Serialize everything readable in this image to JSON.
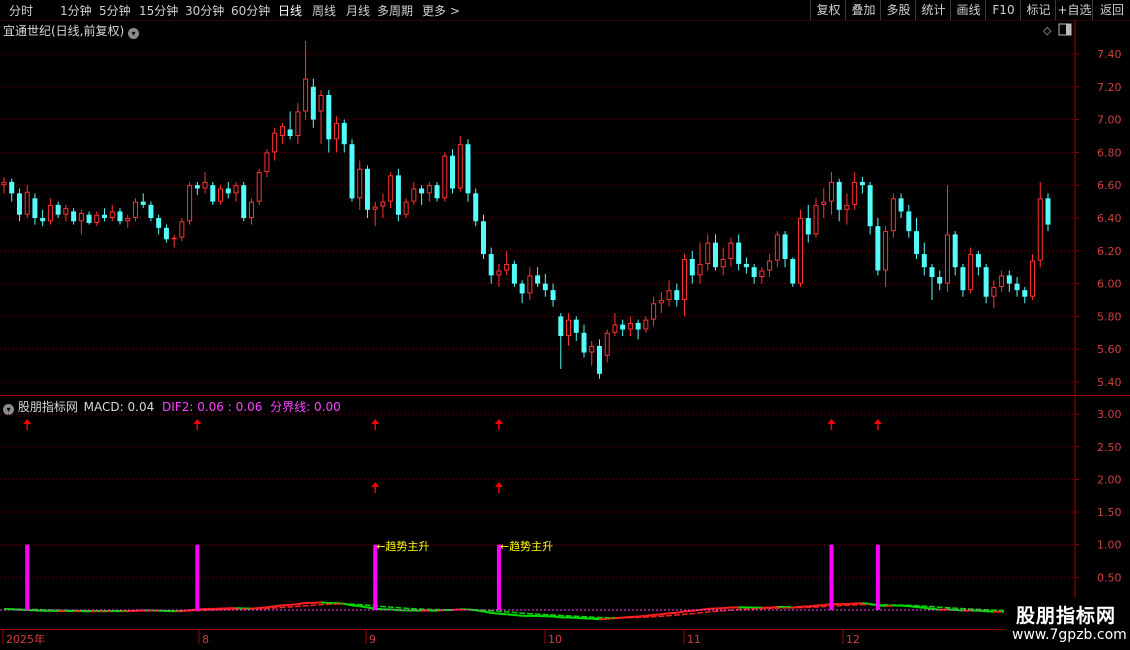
{
  "toolbar": {
    "periods": [
      "分时",
      "1分钟",
      "5分钟",
      "15分钟",
      "30分钟",
      "60分钟",
      "日线",
      "周线",
      "月线",
      "多周期",
      "更多 >"
    ],
    "active_period": "日线",
    "right_buttons": [
      "复权",
      "叠加",
      "多股",
      "统计",
      "画线",
      "F10",
      "标记",
      "+自选",
      "返回"
    ]
  },
  "main_panel": {
    "title": "宜通世纪(日线,前复权)",
    "price_axis": [
      "7.40",
      "7.20",
      "7.00",
      "6.80",
      "6.60",
      "6.40",
      "6.20",
      "6.00",
      "5.80",
      "5.60",
      "5.40"
    ]
  },
  "indicator_panel": {
    "name": "股朋指标网",
    "macd_label": "MACD: 0.04",
    "dif2_label": "DIF2: 0.06",
    "extra_label": ": 0.06",
    "divider_label": "分界线: 0.00",
    "axis": [
      "3.00",
      "2.50",
      "2.00",
      "1.50",
      "1.00",
      "0.50"
    ],
    "signal_text": "←趋势主升"
  },
  "date_axis": [
    "2025年",
    "8",
    "9",
    "10",
    "11",
    "12"
  ],
  "watermark": {
    "title": "股朋指标网",
    "url": "www.7gpzb.com"
  },
  "colors": {
    "up": "#ff3232",
    "down": "#54fcfc",
    "signal_bar": "#ff00ff",
    "arrow": "#ff0000",
    "dif_line_up": "#ff2020",
    "dif_line_down": "#00dd00",
    "label_text": "#ffff00"
  },
  "chart_data": {
    "type": "candlestick",
    "ylim": [
      5.35,
      7.5
    ],
    "candles": [
      [
        6.6,
        6.65,
        6.55,
        6.62
      ],
      [
        6.62,
        6.64,
        6.5,
        6.55
      ],
      [
        6.55,
        6.58,
        6.38,
        6.42
      ],
      [
        6.42,
        6.6,
        6.4,
        6.56
      ],
      [
        6.52,
        6.55,
        6.36,
        6.4
      ],
      [
        6.4,
        6.45,
        6.35,
        6.38
      ],
      [
        6.38,
        6.52,
        6.36,
        6.48
      ],
      [
        6.48,
        6.5,
        6.4,
        6.42
      ],
      [
        6.42,
        6.48,
        6.38,
        6.46
      ],
      [
        6.44,
        6.46,
        6.36,
        6.38
      ],
      [
        6.38,
        6.45,
        6.3,
        6.43
      ],
      [
        6.42,
        6.44,
        6.36,
        6.37
      ],
      [
        6.37,
        6.44,
        6.35,
        6.42
      ],
      [
        6.42,
        6.46,
        6.38,
        6.4
      ],
      [
        6.4,
        6.48,
        6.38,
        6.44
      ],
      [
        6.44,
        6.46,
        6.36,
        6.38
      ],
      [
        6.38,
        6.42,
        6.34,
        6.4
      ],
      [
        6.4,
        6.52,
        6.38,
        6.5
      ],
      [
        6.5,
        6.55,
        6.46,
        6.48
      ],
      [
        6.48,
        6.5,
        6.38,
        6.4
      ],
      [
        6.4,
        6.42,
        6.3,
        6.34
      ],
      [
        6.34,
        6.36,
        6.25,
        6.27
      ],
      [
        6.27,
        6.3,
        6.22,
        6.28
      ],
      [
        6.28,
        6.4,
        6.26,
        6.38
      ],
      [
        6.38,
        6.62,
        6.36,
        6.6
      ],
      [
        6.6,
        6.62,
        6.54,
        6.58
      ],
      [
        6.58,
        6.68,
        6.55,
        6.62
      ],
      [
        6.6,
        6.62,
        6.48,
        6.5
      ],
      [
        6.5,
        6.6,
        6.48,
        6.58
      ],
      [
        6.58,
        6.62,
        6.52,
        6.55
      ],
      [
        6.55,
        6.62,
        6.5,
        6.6
      ],
      [
        6.6,
        6.62,
        6.38,
        6.4
      ],
      [
        6.4,
        6.52,
        6.36,
        6.5
      ],
      [
        6.5,
        6.7,
        6.48,
        6.68
      ],
      [
        6.68,
        6.82,
        6.65,
        6.8
      ],
      [
        6.8,
        6.95,
        6.75,
        6.92
      ],
      [
        6.9,
        6.98,
        6.85,
        6.96
      ],
      [
        6.94,
        7.05,
        6.88,
        6.9
      ],
      [
        6.9,
        7.1,
        6.85,
        7.05
      ],
      [
        7.05,
        7.48,
        7.0,
        7.25
      ],
      [
        7.2,
        7.25,
        6.95,
        7.0
      ],
      [
        7.05,
        7.18,
        6.85,
        7.15
      ],
      [
        7.15,
        7.18,
        6.8,
        6.88
      ],
      [
        6.88,
        7.02,
        6.8,
        6.98
      ],
      [
        6.98,
        7.0,
        6.8,
        6.85
      ],
      [
        6.85,
        6.88,
        6.5,
        6.52
      ],
      [
        6.52,
        6.75,
        6.45,
        6.7
      ],
      [
        6.7,
        6.72,
        6.4,
        6.45
      ],
      [
        6.45,
        6.5,
        6.35,
        6.47
      ],
      [
        6.47,
        6.55,
        6.4,
        6.5
      ],
      [
        6.5,
        6.68,
        6.46,
        6.66
      ],
      [
        6.66,
        6.7,
        6.38,
        6.42
      ],
      [
        6.42,
        6.52,
        6.4,
        6.5
      ],
      [
        6.5,
        6.62,
        6.48,
        6.58
      ],
      [
        6.58,
        6.6,
        6.48,
        6.55
      ],
      [
        6.55,
        6.62,
        6.5,
        6.6
      ],
      [
        6.6,
        6.62,
        6.5,
        6.52
      ],
      [
        6.52,
        6.8,
        6.5,
        6.78
      ],
      [
        6.78,
        6.82,
        6.55,
        6.58
      ],
      [
        6.58,
        6.9,
        6.56,
        6.85
      ],
      [
        6.85,
        6.88,
        6.5,
        6.55
      ],
      [
        6.55,
        6.58,
        6.35,
        6.38
      ],
      [
        6.38,
        6.42,
        6.15,
        6.18
      ],
      [
        6.18,
        6.22,
        6.0,
        6.05
      ],
      [
        6.05,
        6.12,
        5.98,
        6.08
      ],
      [
        6.08,
        6.2,
        6.05,
        6.12
      ],
      [
        6.12,
        6.14,
        5.98,
        6.0
      ],
      [
        6.0,
        6.02,
        5.88,
        5.94
      ],
      [
        5.94,
        6.1,
        5.9,
        6.05
      ],
      [
        6.05,
        6.1,
        5.98,
        6.0
      ],
      [
        6.0,
        6.06,
        5.92,
        5.96
      ],
      [
        5.96,
        6.0,
        5.86,
        5.9
      ],
      [
        5.8,
        5.82,
        5.48,
        5.68
      ],
      [
        5.68,
        5.82,
        5.62,
        5.78
      ],
      [
        5.78,
        5.8,
        5.65,
        5.7
      ],
      [
        5.7,
        5.75,
        5.55,
        5.58
      ],
      [
        5.58,
        5.65,
        5.5,
        5.62
      ],
      [
        5.62,
        5.66,
        5.42,
        5.45
      ],
      [
        5.56,
        5.72,
        5.52,
        5.7
      ],
      [
        5.7,
        5.82,
        5.68,
        5.75
      ],
      [
        5.75,
        5.78,
        5.68,
        5.72
      ],
      [
        5.72,
        5.8,
        5.68,
        5.76
      ],
      [
        5.76,
        5.78,
        5.66,
        5.72
      ],
      [
        5.72,
        5.8,
        5.7,
        5.78
      ],
      [
        5.78,
        5.92,
        5.74,
        5.88
      ],
      [
        5.88,
        5.95,
        5.82,
        5.9
      ],
      [
        5.9,
        6.02,
        5.86,
        5.96
      ],
      [
        5.96,
        6.0,
        5.86,
        5.9
      ],
      [
        5.9,
        6.18,
        5.8,
        6.15
      ],
      [
        6.15,
        6.2,
        6.0,
        6.05
      ],
      [
        6.05,
        6.25,
        6.0,
        6.12
      ],
      [
        6.12,
        6.3,
        6.08,
        6.25
      ],
      [
        6.25,
        6.3,
        6.08,
        6.1
      ],
      [
        6.1,
        6.22,
        6.05,
        6.15
      ],
      [
        6.15,
        6.28,
        6.1,
        6.25
      ],
      [
        6.25,
        6.3,
        6.08,
        6.12
      ],
      [
        6.12,
        6.16,
        6.06,
        6.1
      ],
      [
        6.1,
        6.12,
        6.0,
        6.04
      ],
      [
        6.04,
        6.1,
        6.0,
        6.08
      ],
      [
        6.08,
        6.18,
        6.04,
        6.14
      ],
      [
        6.14,
        6.32,
        6.1,
        6.3
      ],
      [
        6.3,
        6.32,
        6.1,
        6.15
      ],
      [
        6.15,
        6.16,
        5.98,
        6.0
      ],
      [
        6.0,
        6.45,
        5.98,
        6.4
      ],
      [
        6.4,
        6.48,
        6.25,
        6.3
      ],
      [
        6.3,
        6.52,
        6.28,
        6.48
      ],
      [
        6.48,
        6.58,
        6.4,
        6.5
      ],
      [
        6.5,
        6.68,
        6.42,
        6.62
      ],
      [
        6.62,
        6.64,
        6.38,
        6.45
      ],
      [
        6.45,
        6.55,
        6.36,
        6.48
      ],
      [
        6.48,
        6.68,
        6.45,
        6.62
      ],
      [
        6.62,
        6.65,
        6.55,
        6.6
      ],
      [
        6.6,
        6.62,
        6.3,
        6.35
      ],
      [
        6.35,
        6.4,
        6.05,
        6.08
      ],
      [
        6.08,
        6.35,
        5.98,
        6.32
      ],
      [
        6.32,
        6.55,
        6.28,
        6.52
      ],
      [
        6.52,
        6.55,
        6.4,
        6.44
      ],
      [
        6.44,
        6.48,
        6.28,
        6.32
      ],
      [
        6.32,
        6.4,
        6.15,
        6.18
      ],
      [
        6.18,
        6.25,
        6.05,
        6.1
      ],
      [
        6.1,
        6.12,
        5.9,
        6.04
      ],
      [
        6.04,
        6.08,
        5.96,
        6.0
      ],
      [
        6.0,
        6.6,
        5.95,
        6.3
      ],
      [
        6.3,
        6.32,
        6.05,
        6.1
      ],
      [
        6.1,
        6.12,
        5.92,
        5.96
      ],
      [
        5.96,
        6.22,
        5.94,
        6.18
      ],
      [
        6.18,
        6.2,
        6.05,
        6.1
      ],
      [
        6.1,
        6.12,
        5.88,
        5.92
      ],
      [
        5.92,
        6.02,
        5.85,
        5.98
      ],
      [
        5.98,
        6.08,
        5.95,
        6.05
      ],
      [
        6.05,
        6.08,
        5.95,
        6.0
      ],
      [
        6.0,
        6.04,
        5.92,
        5.96
      ],
      [
        5.96,
        5.98,
        5.88,
        5.92
      ],
      [
        5.92,
        6.18,
        5.9,
        6.14
      ],
      [
        6.14,
        6.62,
        6.1,
        6.52
      ],
      [
        6.52,
        6.55,
        6.32,
        6.36
      ]
    ],
    "signal_bars": [
      {
        "index": 3,
        "value": 1.0
      },
      {
        "index": 25,
        "value": 1.0
      },
      {
        "index": 48,
        "value": 1.0
      },
      {
        "index": 64,
        "value": 1.0
      },
      {
        "index": 107,
        "value": 1.0
      },
      {
        "index": 113,
        "value": 1.0
      }
    ],
    "arrows_upper": [
      3,
      25,
      48,
      64,
      107,
      113
    ],
    "arrows_lower": [
      48,
      64
    ],
    "signal_labels": [
      48,
      64
    ],
    "indicator_ylim": [
      0,
      3.3
    ]
  }
}
